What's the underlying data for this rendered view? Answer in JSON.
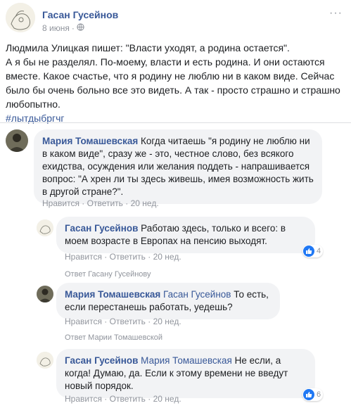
{
  "post": {
    "author": "Гасан Гусейнов",
    "date": "8 июня",
    "separator": "·",
    "audience_icon": "globe-icon",
    "more_icon": "more-icon",
    "lines": [
      "Людмила Улицкая пишет: \"Власти уходят, а родина остается\".",
      "А я бы не разделял. По-моему, власти и есть родина. И они остаются вместе. Какое счастье, что я родину не люблю ни в каком виде. Сейчас было бы очень больно все это видеть. А так - просто страшно и страшно любопытно."
    ],
    "hashtag": "#лытдыбргчг"
  },
  "comments": [
    {
      "author": "Мария Томашевская",
      "text": "Когда читаешь \"я родину не люблю ни в каком виде\", сразу же - это, честное слово, без всякого ехидства, осуждения или желания поддеть - напрашивается вопрос: \"А хрен ли ты здесь живешь, имея возможность жить в другой стране?\".",
      "like": "Нравится",
      "reply": "Ответить",
      "time": "20 нед."
    },
    {
      "author": "Гасан Гусейнов",
      "text": "Работаю здесь, только и всего: в моем возрасте в Европах на пенсию выходят.",
      "like": "Нравится",
      "reply": "Ответить",
      "time": "20 нед.",
      "reaction_count": "4",
      "reply_to": "Ответ Гасану Гусейнову"
    },
    {
      "author": "Мария Томашевская",
      "mention": "Гасан Гусейнов",
      "text": "То есть, если перестанешь работать, уедешь?",
      "like": "Нравится",
      "reply": "Ответить",
      "time": "20 нед.",
      "reply_to": "Ответ Марии Томашевской"
    },
    {
      "author": "Гасан Гусейнов",
      "mention": "Мария Томашевская",
      "text": "Не если, а когда! Думаю, да. Если к этому времени не введут новый порядок.",
      "like": "Нравится",
      "reply": "Ответить",
      "time": "20 нед.",
      "reaction_count": "6"
    }
  ],
  "colors": {
    "link": "#385898",
    "meta": "#90949c",
    "bubble": "#f2f3f5",
    "like": "#2078f4"
  }
}
